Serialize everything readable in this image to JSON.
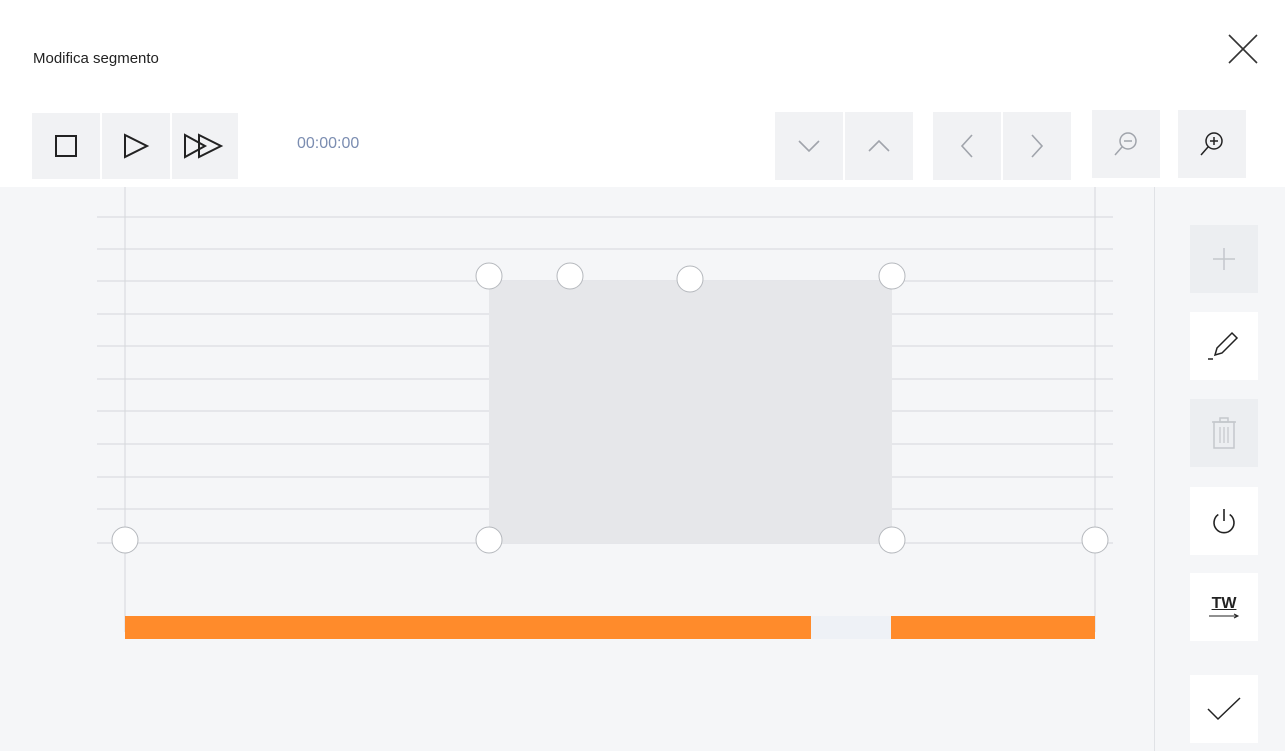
{
  "header": {
    "title": "Modifica segmento",
    "close_icon": "close-icon"
  },
  "toolbar": {
    "time": "00:00:00",
    "left_buttons": [
      "stop-icon",
      "play-icon",
      "fast-forward-icon"
    ],
    "right_buttons": [
      "chevron-down-icon",
      "chevron-up-icon",
      "chevron-left-icon",
      "chevron-right-icon",
      "zoom-out-icon",
      "zoom-in-icon"
    ]
  },
  "sidebar": {
    "buttons": [
      {
        "name": "add-button",
        "icon": "plus-icon",
        "enabled": false
      },
      {
        "name": "edit-button",
        "icon": "pencil-icon",
        "enabled": true
      },
      {
        "name": "delete-button",
        "icon": "trash-icon",
        "enabled": false
      },
      {
        "name": "power-button",
        "icon": "power-icon",
        "enabled": true
      },
      {
        "name": "tw-button",
        "icon": "tw-icon",
        "label": "TW",
        "enabled": true
      },
      {
        "name": "confirm-button",
        "icon": "check-icon",
        "enabled": true
      }
    ]
  },
  "colors": {
    "timeline": "#ff8b2b",
    "time_text": "#7b8db1",
    "segment_fill": "#e6e7ea",
    "canvas": "#f5f6f8"
  }
}
